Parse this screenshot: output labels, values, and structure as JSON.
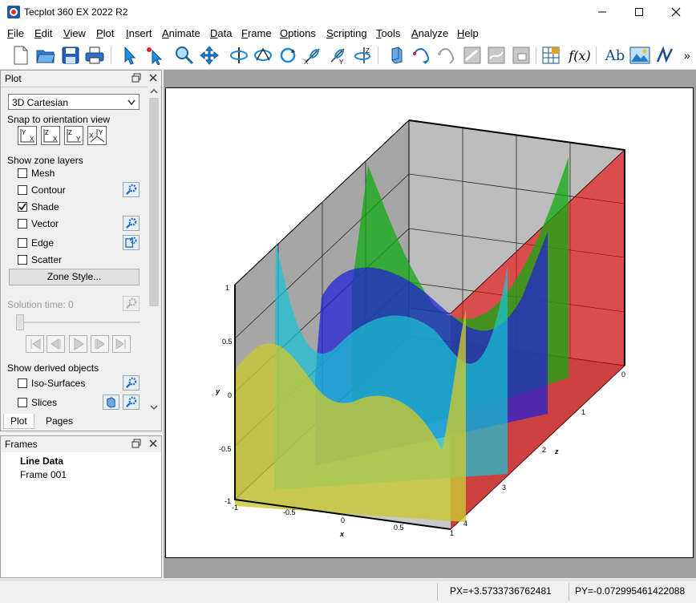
{
  "window": {
    "title": "Tecplot 360 EX 2022 R2",
    "controls": [
      "minimize-icon",
      "maximize-icon",
      "close-icon"
    ]
  },
  "menu": [
    "File",
    "Edit",
    "View",
    "Plot",
    "Insert",
    "Animate",
    "Data",
    "Frame",
    "Options",
    "Scripting",
    "Tools",
    "Analyze",
    "Help"
  ],
  "toolbar": {
    "icons": [
      "new-layout-icon",
      "open-layout-icon",
      "save-icon",
      "print-icon",
      "select-icon",
      "adjustor-icon",
      "zoom-icon",
      "translate-icon",
      "rotate-spherical-icon",
      "rotate-rollerball-icon",
      "rotate-twist-icon",
      "rotate-x-icon",
      "rotate-y-icon",
      "rotate-z-icon",
      "probe-icon",
      "streamtrace-icon",
      "streamtrace-line-icon",
      "slice-icon",
      "contour-line-icon",
      "contour-label-icon",
      "zone-style-icon",
      "equation-icon",
      "text-icon",
      "image-icon",
      "polyline-icon"
    ],
    "equation_label": "f(x)",
    "text_label": "Ab",
    "overflow": "»"
  },
  "plot_panel": {
    "title": "Plot",
    "plot_type": "3D Cartesian",
    "snap_label": "Snap to orientation view",
    "snap_views": [
      [
        "Y",
        "X"
      ],
      [
        "Z",
        "X"
      ],
      [
        "Z",
        "Y"
      ],
      [
        "X",
        "Y"
      ]
    ],
    "zone_layers_label": "Show zone layers",
    "layers": [
      {
        "label": "Mesh",
        "checked": false,
        "has_settings": false
      },
      {
        "label": "Contour",
        "checked": false,
        "has_settings": true
      },
      {
        "label": "Shade",
        "checked": true,
        "has_settings": false
      },
      {
        "label": "Vector",
        "checked": false,
        "has_settings": true
      },
      {
        "label": "Edge",
        "checked": false,
        "has_settings": true
      },
      {
        "label": "Scatter",
        "checked": false,
        "has_settings": false
      }
    ],
    "zone_style_button": "Zone Style...",
    "solution_time_label": "Solution time:",
    "solution_time_value": "0",
    "derived_label": "Show derived objects",
    "derived": [
      {
        "label": "Iso-Surfaces",
        "checked": false
      },
      {
        "label": "Slices",
        "checked": false
      }
    ],
    "tabs": [
      "Plot",
      "Pages"
    ]
  },
  "frames_panel": {
    "title": "Frames",
    "page_name": "Line Data",
    "frames": [
      "Frame 001"
    ]
  },
  "plot_axes": {
    "x_label": "x",
    "y_label": "y",
    "z_label": "z",
    "x_ticks": [
      "-1",
      "-0.5",
      "0",
      "0.5",
      "1"
    ],
    "y_ticks": [
      "-1",
      "-0.5",
      "0",
      "0.5",
      "1"
    ],
    "z_ticks": [
      "0",
      "1",
      "2",
      "3",
      "4"
    ]
  },
  "ribbon_colors": [
    "#c8c833",
    "#19c4d4",
    "#1f1fd6",
    "#11aa11",
    "#cc1111"
  ],
  "status": {
    "px": "PX=+3.5733736762481",
    "py": "PY=-0.072995461422088"
  }
}
